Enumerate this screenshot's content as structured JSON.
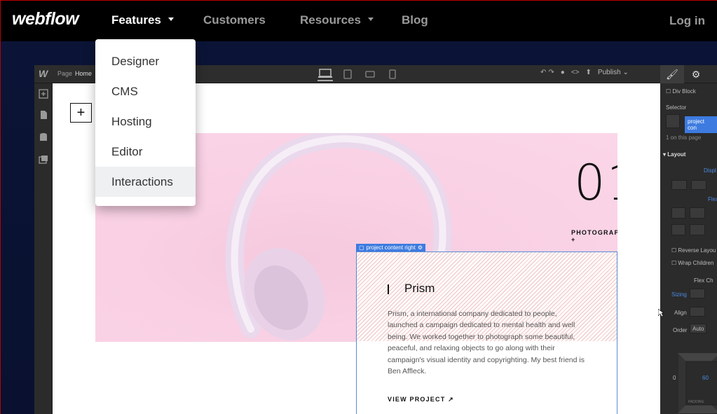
{
  "nav": {
    "logo": "webflow",
    "items": [
      {
        "label": "Features",
        "active": true,
        "has_caret": true
      },
      {
        "label": "Customers",
        "active": false,
        "has_caret": false
      },
      {
        "label": "Resources",
        "active": false,
        "has_caret": true
      },
      {
        "label": "Blog",
        "active": false,
        "has_caret": false
      }
    ],
    "login": "Log in"
  },
  "dropdown": {
    "items": [
      "Designer",
      "CMS",
      "Hosting",
      "Editor",
      "Interactions"
    ],
    "hovered": "Interactions"
  },
  "designer": {
    "logo": "W",
    "page_label": "Page",
    "page_name": "Home",
    "publish": "Publish",
    "panel": {
      "element": "Div Block",
      "selector_label": "Selector",
      "selector_chip": "project con",
      "on_page": "1 on this page",
      "layout_header": "Layout",
      "display": "Displ",
      "flex": "Flex",
      "reverse": "Reverse Layou",
      "wrap": "Wrap Children",
      "flex_child": "Flex Ch",
      "sizing": "Sizing",
      "align": "Align",
      "order": "Order",
      "order_value": "Auto",
      "box_value": "60",
      "box_zero": "0",
      "box_label": "PADDING"
    }
  },
  "canvas": {
    "number": "01",
    "category": "PHOTOGRAPHY +",
    "selection_label": "project content right",
    "title": "Prism",
    "body": "Prism, a international company dedicated to people, launched a campaign dedicated to mental health and well being. We worked together to photograph some beautiful, peaceful, and relaxing objects to go along with their campaign's visual identity and copyrighting. My best friend is Ben Affleck.",
    "link": "VIEW PROJECT ↗"
  },
  "colors": {
    "accent": "#3d7be0",
    "pink": "#f9d0e4"
  }
}
